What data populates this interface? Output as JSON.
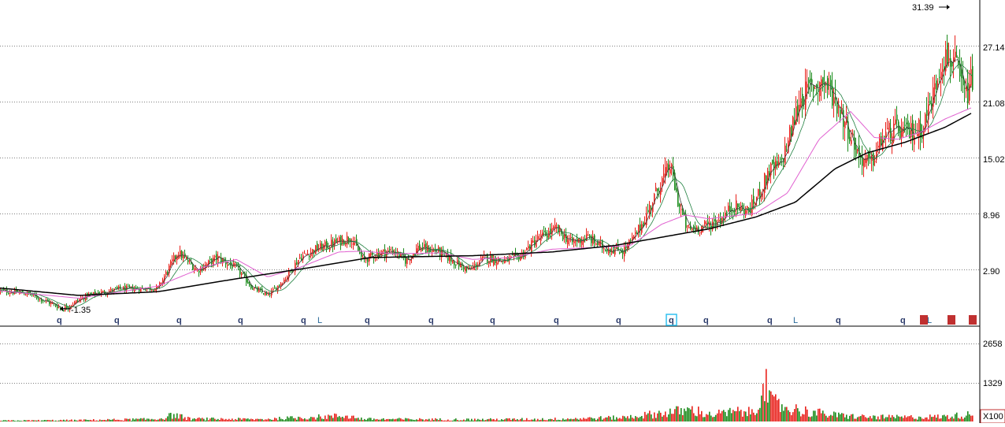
{
  "chart_data": {
    "type": "candlestick",
    "price_panel": {
      "y_ticks": [
        "31.39",
        "27.14",
        "21.08",
        "15.02",
        "8.96",
        "2.90"
      ],
      "y_tick_values": [
        27.14,
        21.08,
        15.02,
        8.96,
        2.9
      ],
      "ylim": [
        -1.35,
        31.39
      ],
      "grid": "horizontal dotted",
      "high_label": "31.39",
      "low_label": "-1.35",
      "close_trend": [
        [
          0,
          0.6
        ],
        [
          35,
          0.3
        ],
        [
          80,
          -1.35
        ],
        [
          110,
          0.1
        ],
        [
          150,
          0.8
        ],
        [
          200,
          0.9
        ],
        [
          225,
          4.8
        ],
        [
          250,
          2.8
        ],
        [
          275,
          4.2
        ],
        [
          300,
          3.0
        ],
        [
          320,
          0.9
        ],
        [
          340,
          0.1
        ],
        [
          360,
          1.8
        ],
        [
          380,
          4.2
        ],
        [
          400,
          5.1
        ],
        [
          425,
          5.8
        ],
        [
          445,
          6.4
        ],
        [
          460,
          3.9
        ],
        [
          480,
          4.7
        ],
        [
          500,
          4.9
        ],
        [
          515,
          3.8
        ],
        [
          530,
          5.3
        ],
        [
          555,
          4.9
        ],
        [
          575,
          3.8
        ],
        [
          595,
          2.8
        ],
        [
          615,
          4.2
        ],
        [
          640,
          3.8
        ],
        [
          660,
          4.4
        ],
        [
          680,
          6.1
        ],
        [
          705,
          7.3
        ],
        [
          725,
          5.8
        ],
        [
          745,
          6.4
        ],
        [
          765,
          5.3
        ],
        [
          790,
          4.9
        ],
        [
          805,
          6.4
        ],
        [
          820,
          8.8
        ],
        [
          835,
          11.7
        ],
        [
          850,
          14.2
        ],
        [
          860,
          10.3
        ],
        [
          872,
          7.2
        ],
        [
          895,
          7.6
        ],
        [
          915,
          8.4
        ],
        [
          930,
          9.8
        ],
        [
          950,
          9.2
        ],
        [
          965,
          11.4
        ],
        [
          975,
          13.5
        ],
        [
          990,
          14.2
        ],
        [
          1000,
          16.8
        ],
        [
          1015,
          21.4
        ],
        [
          1030,
          22.7
        ],
        [
          1045,
          23.3
        ],
        [
          1060,
          21.3
        ],
        [
          1075,
          18.4
        ],
        [
          1090,
          15.1
        ],
        [
          1105,
          14.3
        ],
        [
          1120,
          17.2
        ],
        [
          1135,
          18.1
        ],
        [
          1150,
          17.6
        ],
        [
          1170,
          18.2
        ],
        [
          1185,
          22.0
        ],
        [
          1195,
          25.8
        ],
        [
          1210,
          25.6
        ],
        [
          1225,
          21.4
        ],
        [
          1233,
          23.5
        ]
      ],
      "ma_long": [
        [
          0,
          0.9
        ],
        [
          100,
          0.1
        ],
        [
          200,
          0.5
        ],
        [
          300,
          1.9
        ],
        [
          400,
          3.2
        ],
        [
          470,
          4.2
        ],
        [
          600,
          4.4
        ],
        [
          700,
          4.8
        ],
        [
          780,
          5.5
        ],
        [
          840,
          6.4
        ],
        [
          900,
          7.3
        ],
        [
          960,
          8.6
        ],
        [
          1010,
          10.2
        ],
        [
          1060,
          13.8
        ],
        [
          1100,
          15.5
        ],
        [
          1150,
          16.7
        ],
        [
          1200,
          18.3
        ],
        [
          1233,
          19.8
        ]
      ],
      "ma_mid": [
        [
          0,
          0.6
        ],
        [
          100,
          -0.2
        ],
        [
          200,
          1.1
        ],
        [
          260,
          3.2
        ],
        [
          300,
          4.0
        ],
        [
          340,
          2.1
        ],
        [
          380,
          3.1
        ],
        [
          430,
          4.8
        ],
        [
          460,
          4.9
        ],
        [
          500,
          4.6
        ],
        [
          560,
          4.7
        ],
        [
          600,
          4.0
        ],
        [
          650,
          4.2
        ],
        [
          700,
          5.1
        ],
        [
          760,
          5.3
        ],
        [
          800,
          5.5
        ],
        [
          840,
          7.8
        ],
        [
          870,
          8.8
        ],
        [
          900,
          8.4
        ],
        [
          960,
          9.0
        ],
        [
          1000,
          11.2
        ],
        [
          1040,
          17.0
        ],
        [
          1080,
          20.0
        ],
        [
          1110,
          17.2
        ],
        [
          1140,
          17.0
        ],
        [
          1170,
          17.8
        ],
        [
          1200,
          19.2
        ],
        [
          1233,
          20.4
        ]
      ],
      "markers": [
        {
          "label": "q",
          "x": 75
        },
        {
          "label": "q",
          "x": 148
        },
        {
          "label": "q",
          "x": 227
        },
        {
          "label": "q",
          "x": 305
        },
        {
          "label": "q",
          "x": 385
        },
        {
          "label": "L",
          "x": 406
        },
        {
          "label": "q",
          "x": 466
        },
        {
          "label": "q",
          "x": 547
        },
        {
          "label": "q",
          "x": 625
        },
        {
          "label": "q",
          "x": 706
        },
        {
          "label": "q",
          "x": 785
        },
        {
          "label": "q",
          "x": 852
        },
        {
          "label": "q",
          "x": 896
        },
        {
          "label": "q",
          "x": 977
        },
        {
          "label": "L",
          "x": 1010
        },
        {
          "label": "q",
          "x": 1064
        },
        {
          "label": "q",
          "x": 1146
        },
        {
          "label": "L",
          "x": 1180
        }
      ]
    },
    "volume_panel": {
      "y_ticks": [
        "2658",
        "1329"
      ],
      "y_tick_values": [
        2658,
        1329
      ],
      "unit_label": "X100",
      "ylim": [
        0,
        2658
      ],
      "trend": [
        [
          0,
          40
        ],
        [
          100,
          60
        ],
        [
          200,
          110
        ],
        [
          220,
          300
        ],
        [
          240,
          120
        ],
        [
          330,
          100
        ],
        [
          440,
          260
        ],
        [
          460,
          110
        ],
        [
          600,
          90
        ],
        [
          700,
          110
        ],
        [
          790,
          180
        ],
        [
          850,
          420
        ],
        [
          880,
          520
        ],
        [
          900,
          300
        ],
        [
          935,
          440
        ],
        [
          960,
          400
        ],
        [
          968,
          2658
        ],
        [
          975,
          900
        ],
        [
          1000,
          600
        ],
        [
          1030,
          420
        ],
        [
          1060,
          280
        ],
        [
          1100,
          200
        ],
        [
          1150,
          190
        ],
        [
          1200,
          220
        ],
        [
          1233,
          320
        ]
      ]
    },
    "colors": {
      "up": "#e8201a",
      "down": "#1a8a1a",
      "ma_long": "#000000",
      "ma_mid": "#e060d0",
      "ma_short": "#404040",
      "grid": "#808080"
    }
  }
}
